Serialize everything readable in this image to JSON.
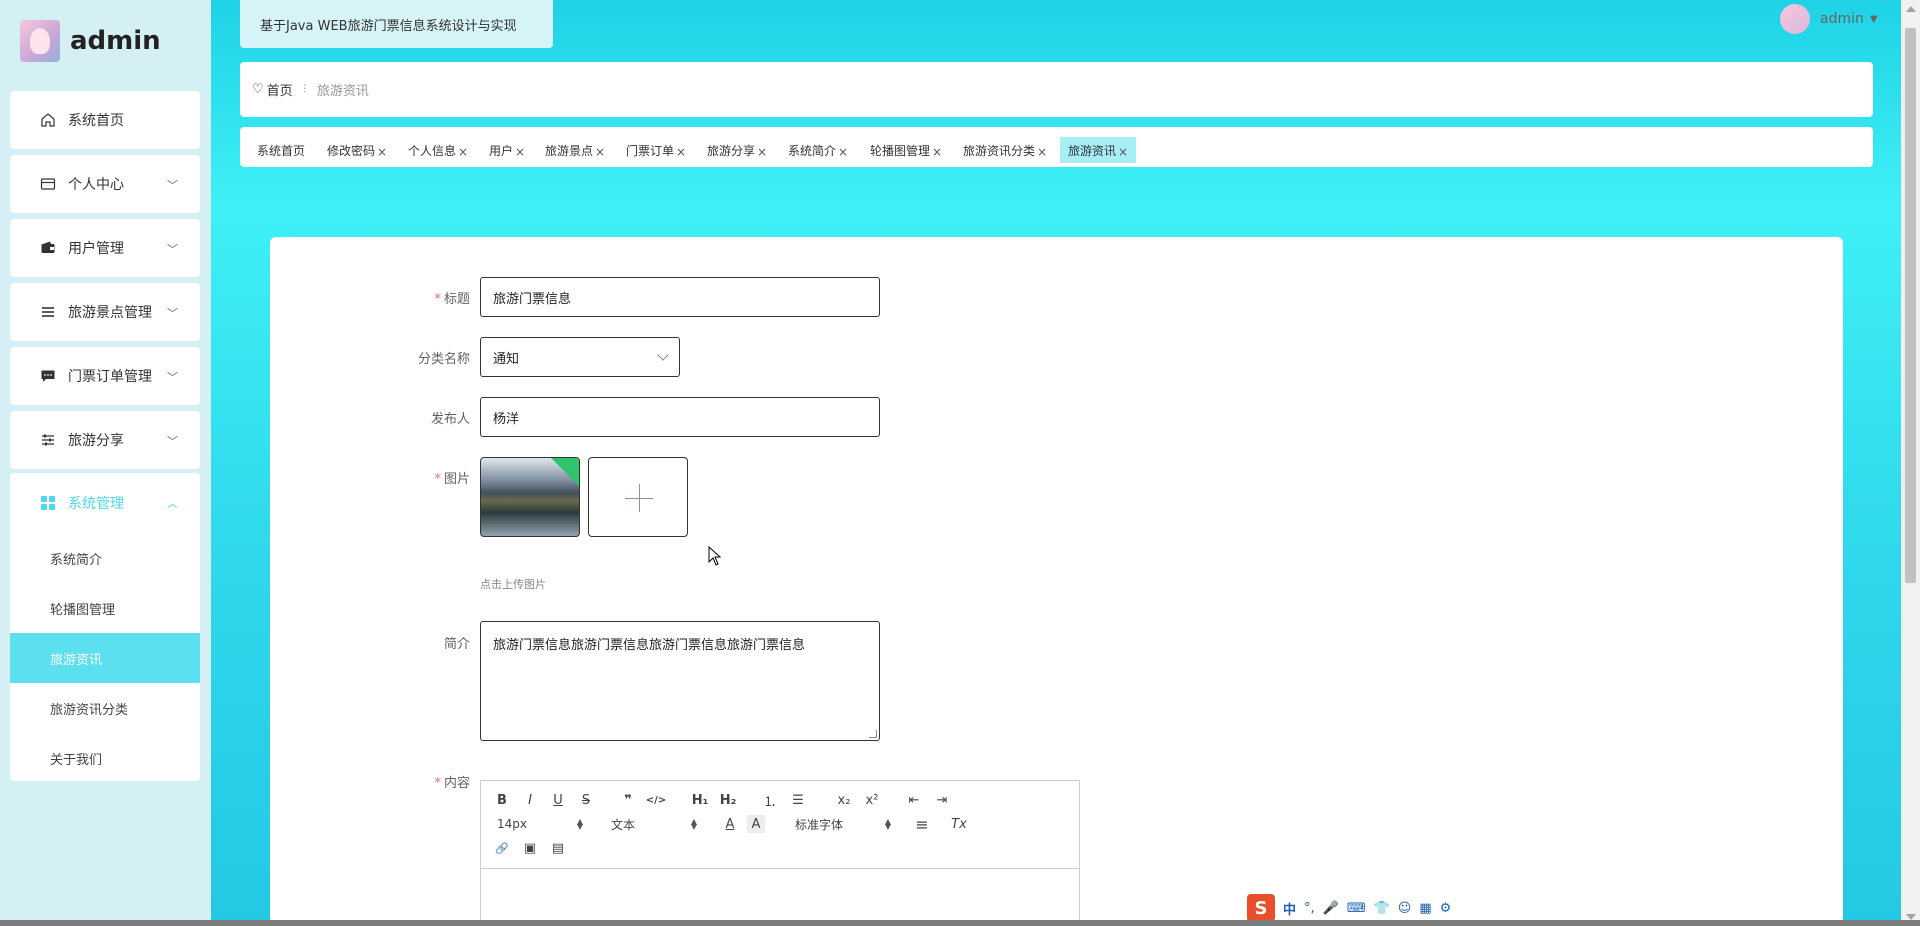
{
  "sidebar": {
    "brand": "admin",
    "menu": [
      {
        "label": "系统首页",
        "icon": "home-icon"
      },
      {
        "label": "个人中心",
        "icon": "id-card-icon"
      },
      {
        "label": "用户管理",
        "icon": "wallet-icon"
      },
      {
        "label": "旅游景点管理",
        "icon": "list-icon"
      },
      {
        "label": "门票订单管理",
        "icon": "chat-icon"
      },
      {
        "label": "旅游分享",
        "icon": "sliders-icon"
      }
    ],
    "system": {
      "label": "系统管理",
      "icon": "grid-icon",
      "items": [
        "系统简介",
        "轮播图管理",
        "旅游资讯",
        "旅游资讯分类",
        "关于我们"
      ]
    }
  },
  "header": {
    "site_title": "基于Java WEB旅游门票信息系统设计与实现",
    "user": "admin"
  },
  "breadcrumb": {
    "home": "首页",
    "current": "旅游资讯"
  },
  "tabs": [
    "系统首页",
    "修改密码",
    "个人信息",
    "用户",
    "旅游景点",
    "门票订单",
    "旅游分享",
    "系统简介",
    "轮播图管理",
    "旅游资讯分类",
    "旅游资讯"
  ],
  "tab_close": "×",
  "form": {
    "title_label": "标题",
    "title_value": "旅游门票信息",
    "category_label": "分类名称",
    "category_value": "通知",
    "publisher_label": "发布人",
    "publisher_value": "杨洋",
    "image_label": "图片",
    "upload_tip": "点击上传图片",
    "intro_label": "简介",
    "intro_value": "旅游门票信息旅游门票信息旅游门票信息旅游门票信息",
    "content_label": "内容",
    "required_mark": "*"
  },
  "editor": {
    "font_size": "14px",
    "text_style": "文本",
    "font_family": "标准字体",
    "buttons": {
      "bold": "B",
      "italic": "I",
      "underline": "U",
      "strike": "S",
      "quote": "❞",
      "code": "</>",
      "h1": "H₁",
      "h2": "H₂",
      "ol": "⒈",
      "ul": "☰",
      "sub": "x₂",
      "sup": "x²",
      "outdent": "⇤",
      "indent": "⇥",
      "color": "A",
      "bg": "A",
      "align": "≡",
      "clean": "Tx",
      "link": "🔗",
      "image": "▣",
      "video": "▤"
    }
  },
  "ime": {
    "logo": "S",
    "lang": "中",
    "punct": "°,"
  },
  "colors": {
    "accent": "#5ce0ef",
    "required": "#f56c6c",
    "gradient_top": "#1fd2e6",
    "gradient_mid": "#3ef0f6"
  }
}
